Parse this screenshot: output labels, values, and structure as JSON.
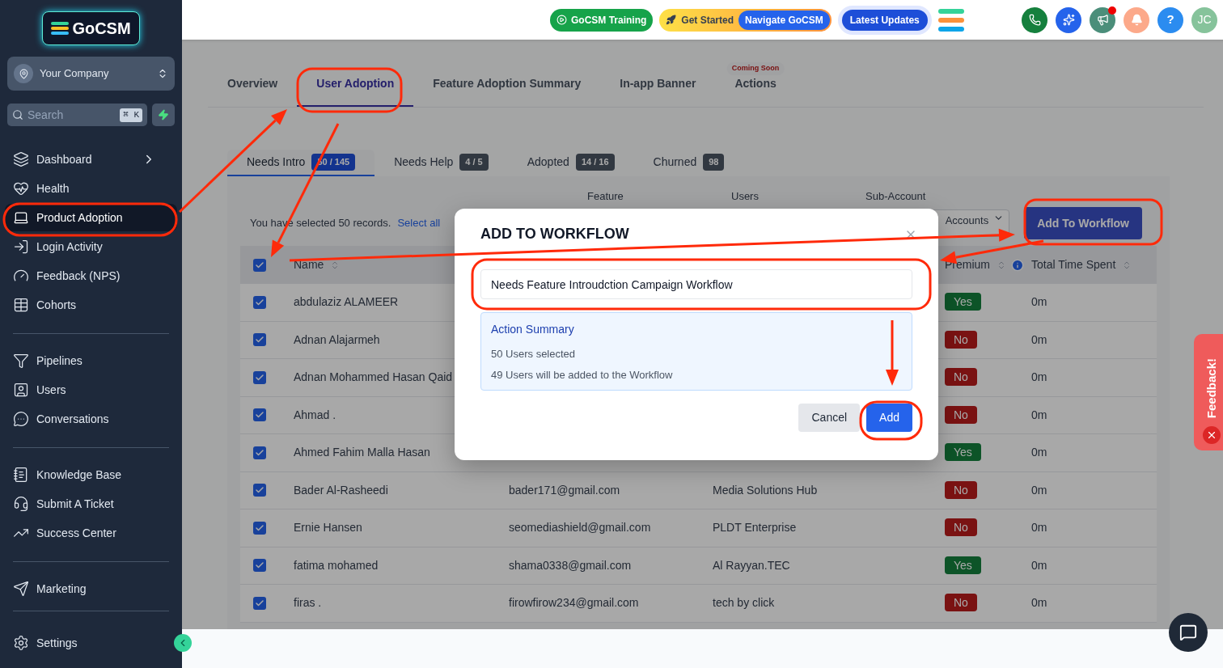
{
  "sidebar": {
    "logo": "GoCSM",
    "company": "Your Company",
    "search": {
      "placeholder": "Search",
      "shortcut": "⌘ K"
    },
    "sections": [
      [
        {
          "label": "Dashboard",
          "selected": false,
          "expandable": true
        },
        {
          "label": "Health",
          "selected": false,
          "expandable": false
        },
        {
          "label": "Product Adoption",
          "selected": true,
          "expandable": false
        },
        {
          "label": "Login Activity",
          "selected": false,
          "expandable": false
        },
        {
          "label": "Feedback (NPS)",
          "selected": false,
          "expandable": false
        },
        {
          "label": "Cohorts",
          "selected": false,
          "expandable": false
        }
      ],
      [
        {
          "label": "Pipelines",
          "selected": false,
          "expandable": false
        },
        {
          "label": "Users",
          "selected": false,
          "expandable": false
        },
        {
          "label": "Conversations",
          "selected": false,
          "expandable": false
        }
      ],
      [
        {
          "label": "Knowledge Base",
          "selected": false,
          "expandable": false
        },
        {
          "label": "Submit A Ticket",
          "selected": false,
          "expandable": false
        },
        {
          "label": "Success Center",
          "selected": false,
          "expandable": false
        }
      ],
      [
        {
          "label": "Marketing",
          "selected": false,
          "expandable": false
        }
      ]
    ],
    "footer_item": {
      "label": "Settings"
    }
  },
  "topbar": {
    "training": "GoCSM Training",
    "get_started": "Get Started",
    "navigate": "Navigate GoCSM",
    "updates": "Latest Updates",
    "help": "?",
    "avatar": "JC",
    "notification_dot": true
  },
  "tabs": [
    {
      "label": "Overview",
      "selected": false
    },
    {
      "label": "User Adoption",
      "selected": true
    },
    {
      "label": "Feature Adoption Summary",
      "selected": false
    },
    {
      "label": "In-app Banner",
      "selected": false
    },
    {
      "label": "Actions",
      "selected": false,
      "tag": "Coming Soon"
    }
  ],
  "subtabs": [
    {
      "label": "Needs Intro",
      "count": "50 / 145",
      "selected": true
    },
    {
      "label": "Needs Help",
      "count": "4 / 5",
      "selected": false
    },
    {
      "label": "Adopted",
      "count": "14 / 16",
      "selected": false
    },
    {
      "label": "Churned",
      "count": "98",
      "selected": false
    }
  ],
  "filters": [
    {
      "label": "Feature"
    },
    {
      "label": "Users"
    },
    {
      "label": "Sub-Account",
      "value": "Accounts"
    }
  ],
  "selection_note": "You have selected 50 records.",
  "select_all": "Select all",
  "add_to_workflow": "Add To Workflow",
  "table": {
    "header_checked": true,
    "columns": [
      {
        "label": "Name",
        "info": false
      },
      {
        "label": "Premium",
        "info": true
      },
      {
        "label": "Total Time Spent",
        "info": false
      }
    ],
    "rows": [
      {
        "checked": true,
        "name": "abdulaziz ALAMEER",
        "premium": "Yes",
        "premium_positive": true,
        "time": "0m"
      },
      {
        "checked": true,
        "name": "Adnan Alajarmeh",
        "premium": "No",
        "premium_positive": false,
        "time": "0m"
      },
      {
        "checked": true,
        "name": "Adnan Mohammed Hasan Qaid",
        "premium": "No",
        "premium_positive": false,
        "time": "0m"
      },
      {
        "checked": true,
        "name": "Ahmad .",
        "premium": "No",
        "premium_positive": false,
        "time": "0m"
      },
      {
        "checked": true,
        "name": "Ahmed Fahim Malla Hasan",
        "premium": "Yes",
        "premium_positive": true,
        "time": "0m"
      },
      {
        "checked": true,
        "name": "Bader Al-Rasheedi",
        "email": "bader171@gmail.com",
        "account": "Media Solutions Hub",
        "premium": "No",
        "premium_positive": false,
        "time": "0m"
      },
      {
        "checked": true,
        "name": "Ernie Hansen",
        "email": "seomediashield@gmail.com",
        "account": "PLDT Enterprise",
        "premium": "No",
        "premium_positive": false,
        "time": "0m"
      },
      {
        "checked": true,
        "name": "fatima mohamed",
        "email": "shama0338@gmail.com",
        "account": "Al Rayyan.TEC",
        "premium": "Yes",
        "premium_positive": true,
        "time": "0m"
      },
      {
        "checked": true,
        "name": "firas .",
        "email": "firowfirow234@gmail.com",
        "account": "tech by click",
        "premium": "No",
        "premium_positive": false,
        "time": "0m"
      }
    ]
  },
  "modal": {
    "title": "ADD TO WORKFLOW",
    "value": "Needs Feature Introudction Campaign Workflow",
    "summary_title": "Action Summary",
    "summary_lines": [
      "50 Users selected",
      "49 Users will be added to the Workflow"
    ],
    "cancel": "Cancel",
    "add": "Add"
  },
  "feedback": {
    "label": "Feedback!"
  }
}
